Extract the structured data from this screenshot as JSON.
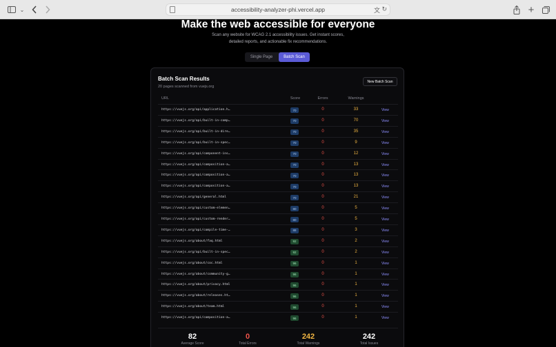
{
  "browser": {
    "url": "accessibility-analyzer-phi.vercel.app",
    "icons": [
      "sidebar-icon",
      "chevron-down-icon",
      "back-icon",
      "forward-icon",
      "page-icon",
      "translate-icon",
      "reload-icon",
      "share-icon",
      "new-tab-icon",
      "tabs-icon"
    ]
  },
  "hero": {
    "title": "Make the web accessible for everyone",
    "subtitle": "Scan any website for WCAG 2.1 accessibility issues. Get instant scores, detailed reports, and actionable fix recommendations."
  },
  "tabs": {
    "single": "Single Page",
    "batch": "Batch Scan"
  },
  "card": {
    "title": "Batch Scan Results",
    "subtitle": "20 pages scanned from vuejs.org",
    "new_batch_label": "New Batch Scan",
    "columns": {
      "url": "URL",
      "score": "Score",
      "errors": "Errors",
      "warnings": "Warnings"
    },
    "view_label": "View",
    "rows": [
      {
        "url": "https://vuejs.org/api/application.h…",
        "score": "70",
        "errors": "0",
        "warnings": "33"
      },
      {
        "url": "https://vuejs.org/api/built-in-comp…",
        "score": "70",
        "errors": "0",
        "warnings": "70"
      },
      {
        "url": "https://vuejs.org/api/built-in-dire…",
        "score": "70",
        "errors": "0",
        "warnings": "35"
      },
      {
        "url": "https://vuejs.org/api/built-in-spec…",
        "score": "70",
        "errors": "0",
        "warnings": "9"
      },
      {
        "url": "https://vuejs.org/api/component-ins…",
        "score": "70",
        "errors": "0",
        "warnings": "12"
      },
      {
        "url": "https://vuejs.org/api/composition-a…",
        "score": "70",
        "errors": "0",
        "warnings": "13"
      },
      {
        "url": "https://vuejs.org/api/composition-a…",
        "score": "70",
        "errors": "0",
        "warnings": "13"
      },
      {
        "url": "https://vuejs.org/api/composition-a…",
        "score": "70",
        "errors": "0",
        "warnings": "13"
      },
      {
        "url": "https://vuejs.org/api/general.html",
        "score": "70",
        "errors": "0",
        "warnings": "21"
      },
      {
        "url": "https://vuejs.org/api/custom-elemen…",
        "score": "80",
        "errors": "0",
        "warnings": "5"
      },
      {
        "url": "https://vuejs.org/api/custom-render…",
        "score": "80",
        "errors": "0",
        "warnings": "5"
      },
      {
        "url": "https://vuejs.org/api/compile-time-…",
        "score": "88",
        "errors": "0",
        "warnings": "3"
      },
      {
        "url": "https://vuejs.org/about/faq.html",
        "score": "92",
        "errors": "0",
        "warnings": "2"
      },
      {
        "url": "https://vuejs.org/api/built-in-spec…",
        "score": "92",
        "errors": "0",
        "warnings": "2"
      },
      {
        "url": "https://vuejs.org/about/coc.html",
        "score": "96",
        "errors": "0",
        "warnings": "1"
      },
      {
        "url": "https://vuejs.org/about/community-g…",
        "score": "96",
        "errors": "0",
        "warnings": "1"
      },
      {
        "url": "https://vuejs.org/about/privacy.html",
        "score": "96",
        "errors": "0",
        "warnings": "1"
      },
      {
        "url": "https://vuejs.org/about/releases.ht…",
        "score": "96",
        "errors": "0",
        "warnings": "1"
      },
      {
        "url": "https://vuejs.org/about/team.html",
        "score": "96",
        "errors": "0",
        "warnings": "1"
      },
      {
        "url": "https://vuejs.org/api/composition-a…",
        "score": "96",
        "errors": "0",
        "warnings": "1"
      }
    ]
  },
  "stats": [
    {
      "value": "82",
      "label": "Average Score"
    },
    {
      "value": "0",
      "label": "Total Errors"
    },
    {
      "value": "242",
      "label": "Total Warnings"
    },
    {
      "value": "242",
      "label": "Total Issues"
    }
  ],
  "colors": {
    "accent": "#5b5bd6",
    "error": "#f0534a",
    "warning": "#f0b542",
    "link": "#8f90ff",
    "score_mid_bg": "#1d3b66",
    "score_high_bg": "#1f4a2f"
  }
}
